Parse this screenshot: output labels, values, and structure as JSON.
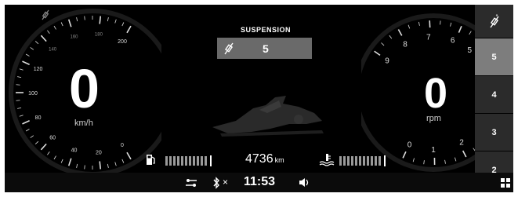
{
  "speed": {
    "value": "0",
    "unit": "km/h",
    "ticks": [
      "0",
      "20",
      "40",
      "60",
      "80",
      "100",
      "120",
      "140",
      "160",
      "180",
      "200"
    ]
  },
  "rpm": {
    "value": "0",
    "unit": "rpm",
    "ticks": [
      "0",
      "1",
      "2",
      "5",
      "6",
      "7",
      "8",
      "9"
    ]
  },
  "suspension": {
    "title": "SUSPENSION",
    "value": "5"
  },
  "suspension_levels": [
    "5",
    "4",
    "3",
    "2"
  ],
  "selected_level": "5",
  "odometer": {
    "value": "4736",
    "unit": "km"
  },
  "fuel_level_segments": 11,
  "temp_level_segments": 11,
  "status_bar": {
    "time": "11:53",
    "bluetooth_state": "×"
  },
  "icons": [
    "shock-absorber-icon",
    "fuel-pump-icon",
    "coolant-temp-icon",
    "settings-icon",
    "bluetooth-icon",
    "volume-icon",
    "grid-menu-icon"
  ],
  "colors": {
    "background": "#000000",
    "selected": "#7d7d7d",
    "panel": "#2b2b2b"
  }
}
